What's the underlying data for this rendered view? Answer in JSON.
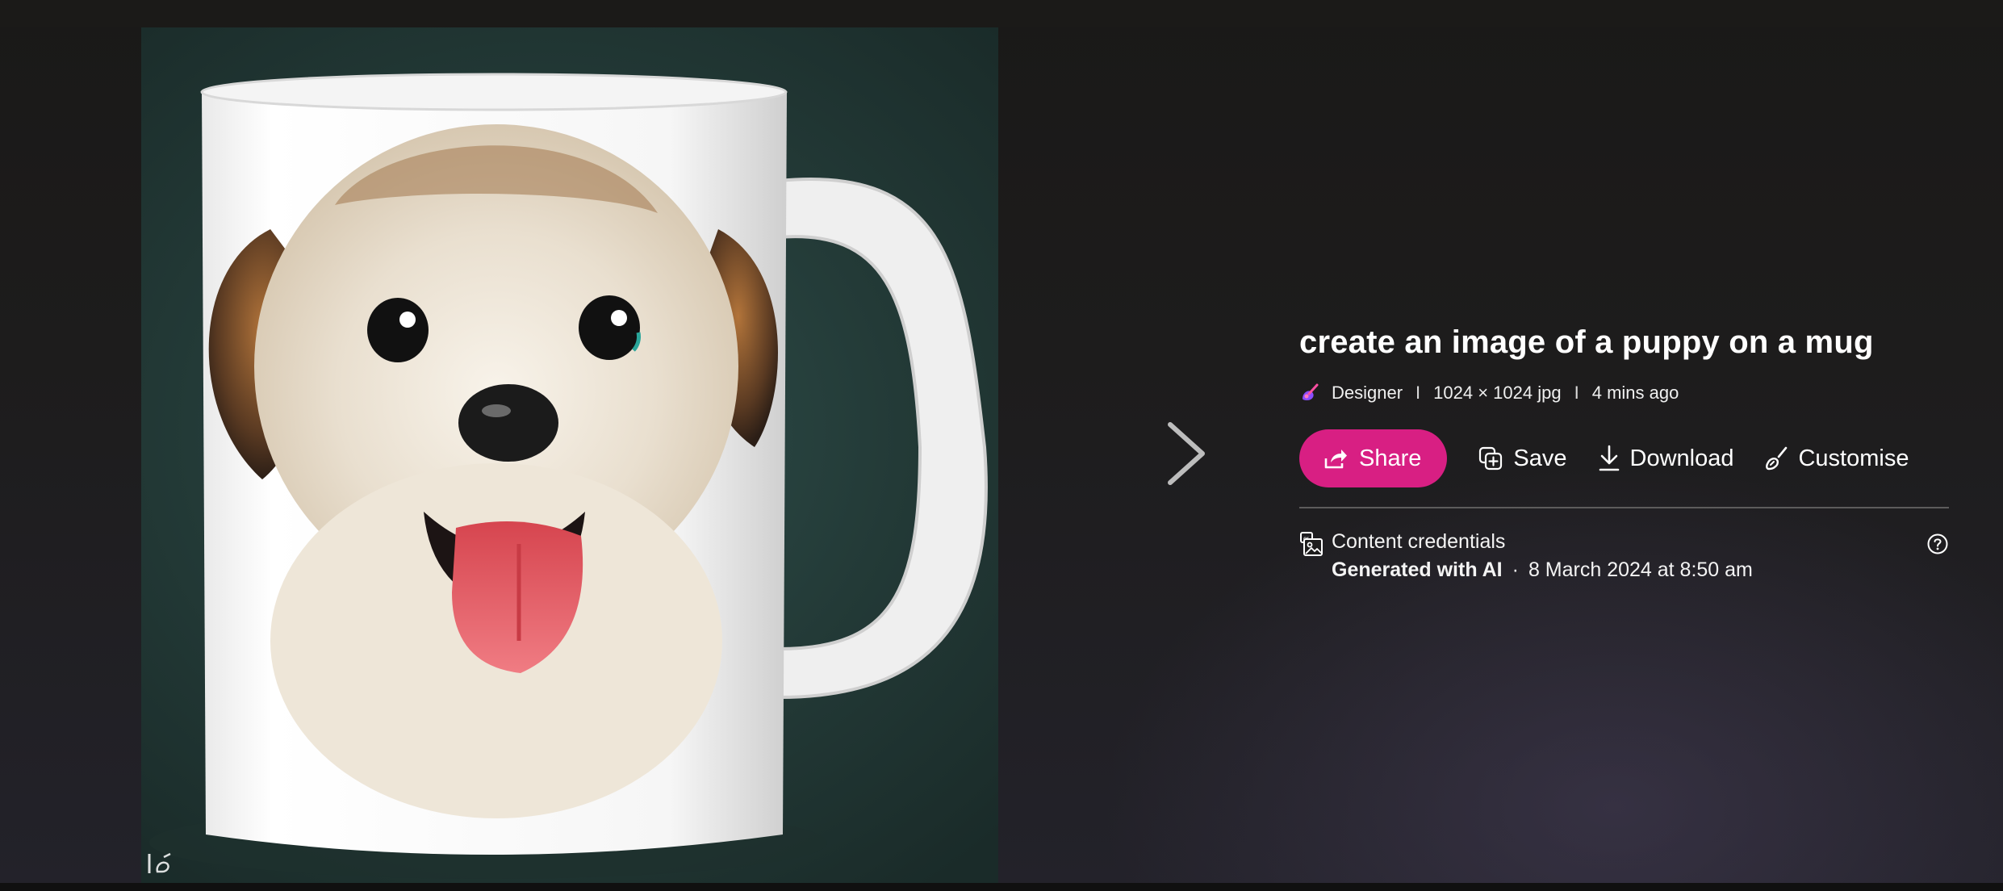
{
  "image": {
    "subject_icon": "puppy-mug-image",
    "watermark_icon": "designer-watermark-icon"
  },
  "navigation": {
    "next_icon": "chevron-right-icon"
  },
  "details": {
    "title": "create an image of a puppy on a mug",
    "meta": {
      "app_icon": "designer-logo-icon",
      "app_name": "Designer",
      "separator": "I",
      "dimensions": "1024 × 1024 jpg",
      "time_ago": "4 mins ago"
    },
    "actions": {
      "share": "Share",
      "save": "Save",
      "download": "Download",
      "customise": "Customise"
    },
    "credentials": {
      "label": "Content credentials",
      "generated": "Generated with AI",
      "separator": "·",
      "date": "8 March 2024 at 8:50 am",
      "help_icon": "help-circle-icon"
    }
  },
  "colors": {
    "share_button": "#d81f83",
    "background": "#1b1a1a",
    "accent_purple": "#8a4dff"
  }
}
